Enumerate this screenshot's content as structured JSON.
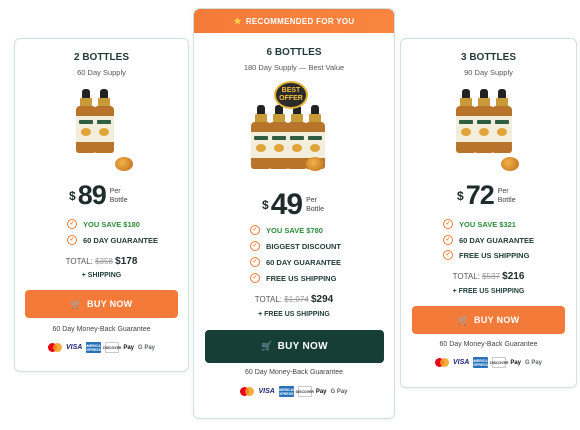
{
  "cards": [
    {
      "title": "2 BOTTLES",
      "supply": "60 Day Supply",
      "currency": "$",
      "price": "89",
      "per": [
        "Per",
        "Bottle"
      ],
      "features": [
        "YOU SAVE $180",
        "60 DAY GUARANTEE"
      ],
      "total_label": "TOTAL:",
      "total_old": "$358",
      "total_new": "$178",
      "shipping": "+ SHIPPING",
      "button": "BUY NOW",
      "guarantee": "60 Day Money-Back Guarantee"
    },
    {
      "recommended": "RECOMMENDED FOR YOU",
      "title": "6 BOTTLES",
      "supply": "180 Day Supply — Best Value",
      "badge": [
        "BEST",
        "OFFER"
      ],
      "currency": "$",
      "price": "49",
      "per": [
        "Per",
        "Bottle"
      ],
      "features": [
        "YOU SAVE $780",
        "BIGGEST DISCOUNT",
        "60 DAY GUARANTEE",
        "FREE US SHIPPING"
      ],
      "total_label": "TOTAL:",
      "total_old": "$1,074",
      "total_new": "$294",
      "shipping": "+ FREE US SHIPPING",
      "button": "BUY NOW",
      "guarantee": "60 Day Money-Back Guarantee"
    },
    {
      "title": "3 BOTTLES",
      "supply": "90 Day Supply",
      "currency": "$",
      "price": "72",
      "per": [
        "Per",
        "Bottle"
      ],
      "features": [
        "YOU SAVE $321",
        "60 DAY GUARANTEE",
        "FREE US SHIPPING"
      ],
      "total_label": "TOTAL:",
      "total_old": "$537",
      "total_new": "$216",
      "shipping": "+ FREE US SHIPPING",
      "button": "BUY NOW",
      "guarantee": "60 Day Money-Back Guarantee"
    }
  ],
  "payments": {
    "visa": "VISA",
    "amex": "AMERICAN EXPRESS",
    "discover": "DISCOVER",
    "apple_pay": " Pay",
    "google_pay": "G Pay"
  },
  "colors": {
    "accent_orange": "#f47a3a",
    "dark_button": "#173d37",
    "save_green": "#2e8b3a",
    "card_border": "#cfe3dc"
  },
  "icons": [
    "star-icon",
    "check-circle-icon",
    "cart-icon",
    "mastercard-icon",
    "visa-icon",
    "amex-icon",
    "discover-icon",
    "apple-pay-icon",
    "google-pay-icon"
  ]
}
